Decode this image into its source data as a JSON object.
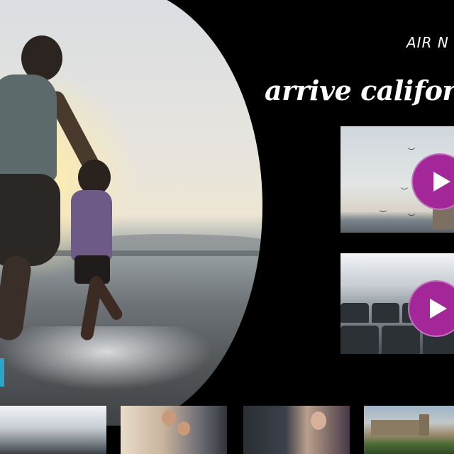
{
  "brand": {
    "text": "AIR N"
  },
  "headline": {
    "text": "arrive califor"
  },
  "videos": [
    {
      "name": "video-california-coast",
      "play_icon": "play-icon"
    },
    {
      "name": "video-cabin-interior",
      "play_icon": "play-icon"
    }
  ],
  "thumbnails": [
    {
      "name": "thumb-cabin"
    },
    {
      "name": "thumb-passengers"
    },
    {
      "name": "thumb-inflight-entertainment"
    },
    {
      "name": "thumb-castle-landscape"
    }
  ],
  "colors": {
    "background": "#000000",
    "play_button": "#a4279a",
    "text": "#ffffff",
    "edge_tab": "#2ea3c7"
  }
}
